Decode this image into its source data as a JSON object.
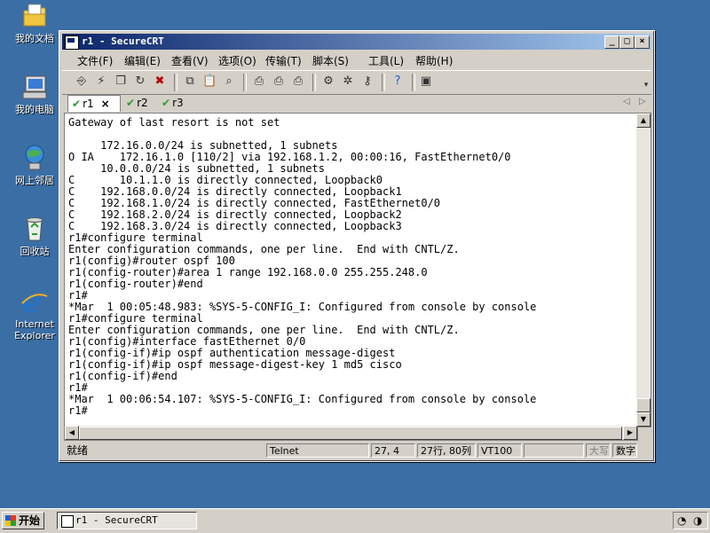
{
  "desktop": {
    "icons": [
      {
        "label": "我的文档",
        "icon": "my-documents-icon"
      },
      {
        "label": "我的电脑",
        "icon": "my-computer-icon"
      },
      {
        "label": "网上邻居",
        "icon": "network-places-icon"
      },
      {
        "label": "回收站",
        "icon": "recycle-bin-icon"
      },
      {
        "label": "Internet Explorer",
        "icon": "internet-explorer-icon"
      }
    ]
  },
  "window": {
    "title": "r1 - SecureCRT",
    "controls": {
      "minimize": "_",
      "maximize": "□",
      "close": "×"
    }
  },
  "menu": [
    "文件(F)",
    "编辑(E)",
    "查看(V)",
    "选项(O)",
    "传输(T)",
    "脚本(S)",
    "工具(L)",
    "帮助(H)"
  ],
  "toolbar": {
    "icons": [
      "connect-icon",
      "quick-connect-icon",
      "connect-tab-icon",
      "reconnect-icon",
      "disconnect-icon",
      "copy-icon",
      "paste-icon",
      "find-icon",
      "print-icon",
      "print-selection-icon",
      "print-setup-icon",
      "session-options-icon",
      "global-options-icon",
      "keymap-icon",
      "help-icon",
      "about-icon"
    ]
  },
  "tabs": [
    {
      "label": "r1",
      "active": true,
      "close": "×"
    },
    {
      "label": "r2",
      "active": false
    },
    {
      "label": "r3",
      "active": false
    }
  ],
  "terminal": {
    "lines": [
      "Gateway of last resort is not set",
      "",
      "     172.16.0.0/24 is subnetted, 1 subnets",
      "O IA    172.16.1.0 [110/2] via 192.168.1.2, 00:00:16, FastEthernet0/0",
      "     10.0.0.0/24 is subnetted, 1 subnets",
      "C       10.1.1.0 is directly connected, Loopback0",
      "C    192.168.0.0/24 is directly connected, Loopback1",
      "C    192.168.1.0/24 is directly connected, FastEthernet0/0",
      "C    192.168.2.0/24 is directly connected, Loopback2",
      "C    192.168.3.0/24 is directly connected, Loopback3",
      "r1#configure terminal",
      "Enter configuration commands, one per line.  End with CNTL/Z.",
      "r1(config)#router ospf 100",
      "r1(config-router)#area 1 range 192.168.0.0 255.255.248.0",
      "r1(config-router)#end",
      "r1#",
      "*Mar  1 00:05:48.983: %SYS-5-CONFIG_I: Configured from console by console",
      "r1#configure terminal",
      "Enter configuration commands, one per line.  End with CNTL/Z.",
      "r1(config)#interface fastEthernet 0/0",
      "r1(config-if)#ip ospf authentication message-digest",
      "r1(config-if)#ip ospf message-digest-key 1 md5 cisco",
      "r1(config-if)#end",
      "r1#",
      "*Mar  1 00:06:54.107: %SYS-5-CONFIG_I: Configured from console by console",
      "r1#"
    ]
  },
  "status": {
    "ready": "就绪",
    "protocol": "Telnet",
    "cursor": "27,  4",
    "rows_cols": "27行, 80列",
    "emulation": "VT100",
    "caps": "大写",
    "num": "数字"
  },
  "taskbar": {
    "start": "开始",
    "task": "r1 - SecureCRT"
  }
}
